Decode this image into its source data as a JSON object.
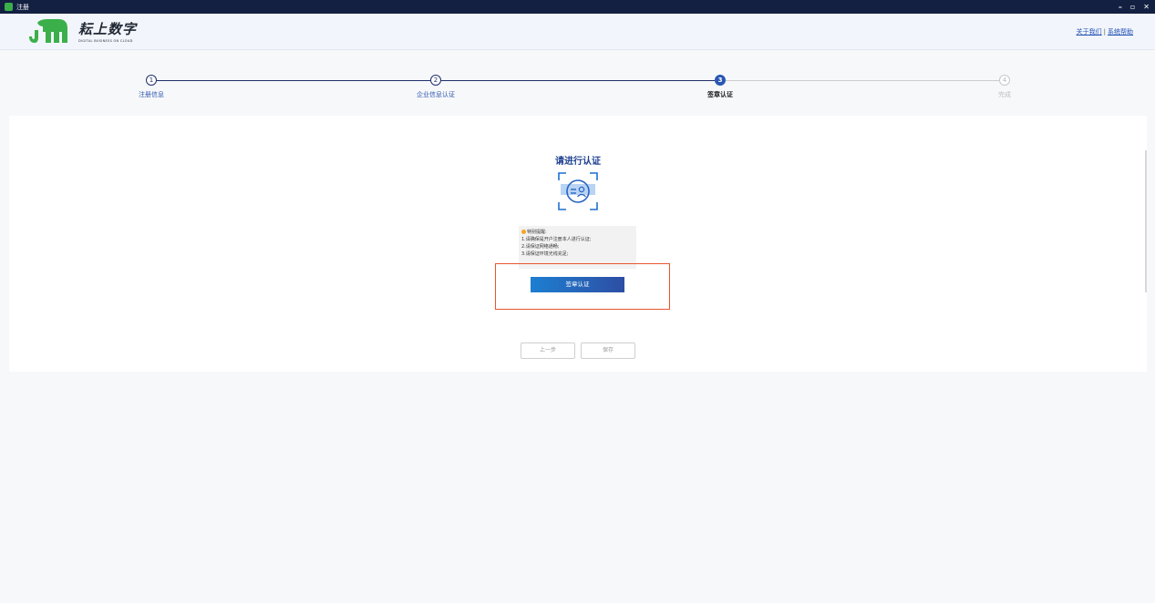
{
  "window": {
    "title": "注册"
  },
  "header": {
    "logo_cn": "耘上数字",
    "logo_en": "DIGITAL BUSINESS ON CLOUD",
    "links": {
      "about": "关于我们",
      "separator": "|",
      "help": "系统帮助"
    }
  },
  "steps": [
    {
      "number": "1",
      "label": "注册信息",
      "state": "done"
    },
    {
      "number": "2",
      "label": "企业信息认证",
      "state": "done"
    },
    {
      "number": "3",
      "label": "签章认证",
      "state": "active"
    },
    {
      "number": "4",
      "label": "完成",
      "state": "todo"
    }
  ],
  "main": {
    "title": "请进行认证",
    "notice": {
      "heading": "特别提醒:",
      "lines": [
        "1.请确保是开户注册本人进行认证;",
        "2.请保证网络通畅;",
        "3.请保证环境光线充足;"
      ]
    },
    "seal_button": "签章认证",
    "prev_button": "上一步",
    "save_button": "保存"
  },
  "colors": {
    "accent": "#2b57b3",
    "highlight": "#e8552f",
    "titlebar": "#132042",
    "logo_green": "#3bb04a"
  },
  "icons": {
    "face": "face-recognition-icon",
    "warning": "warning-icon"
  }
}
